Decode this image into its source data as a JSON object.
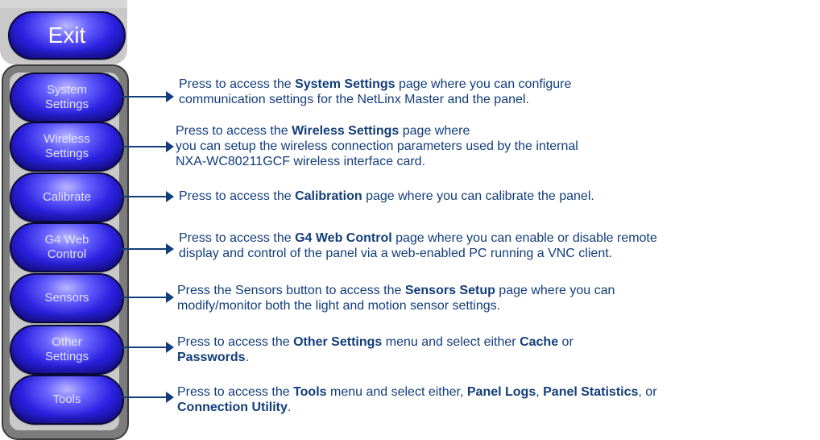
{
  "exit_label": "Exit",
  "buttons": [
    {
      "line1": "System",
      "line2": "Settings"
    },
    {
      "line1": "Wireless",
      "line2": "Settings"
    },
    {
      "line1": "Calibrate",
      "line2": ""
    },
    {
      "line1": "G4 Web",
      "line2": "Control"
    },
    {
      "line1": "Sensors",
      "line2": ""
    },
    {
      "line1": "Other",
      "line2": "Settings"
    },
    {
      "line1": "Tools",
      "line2": ""
    }
  ],
  "descriptions": {
    "system": {
      "pre": "Press to access the ",
      "bold": "System Settings",
      "post": " page where you can configure",
      "line2": "communication settings for the NetLinx Master and the panel."
    },
    "wireless": {
      "pre": "Press to access the ",
      "bold": "Wireless Settings",
      "post": " page where",
      "line2": "you can setup the wireless connection parameters used by the internal",
      "line3": "NXA-WC80211GCF wireless interface card."
    },
    "calibrate": {
      "pre": "Press to access the ",
      "bold": "Calibration",
      "post": " page where you can calibrate the panel."
    },
    "g4web": {
      "pre": "Press to access the ",
      "bold": "G4 Web Control",
      "post": " page where you can enable or disable remote",
      "line2": "display and control of the panel via a web-enabled PC running a VNC client."
    },
    "sensors": {
      "pre": "Press the Sensors button to access the ",
      "bold": "Sensors Setup",
      "post": " page where you can",
      "line2": "modify/monitor both the light and motion sensor settings."
    },
    "other": {
      "pre": "Press to access the ",
      "bold": "Other Settings",
      "mid": " menu and select either ",
      "bold2": "Cache",
      "post": " or",
      "line2_bold": "Passwords",
      "line2_post": "."
    },
    "tools": {
      "pre": "Press to access the ",
      "bold": "Tools",
      "mid": " menu and select either, ",
      "bold2": "Panel Logs",
      "sep": ", ",
      "bold3": "Panel Statistics",
      "post": ", or",
      "line2_bold": "Connection Utility",
      "line2_post": "."
    }
  }
}
